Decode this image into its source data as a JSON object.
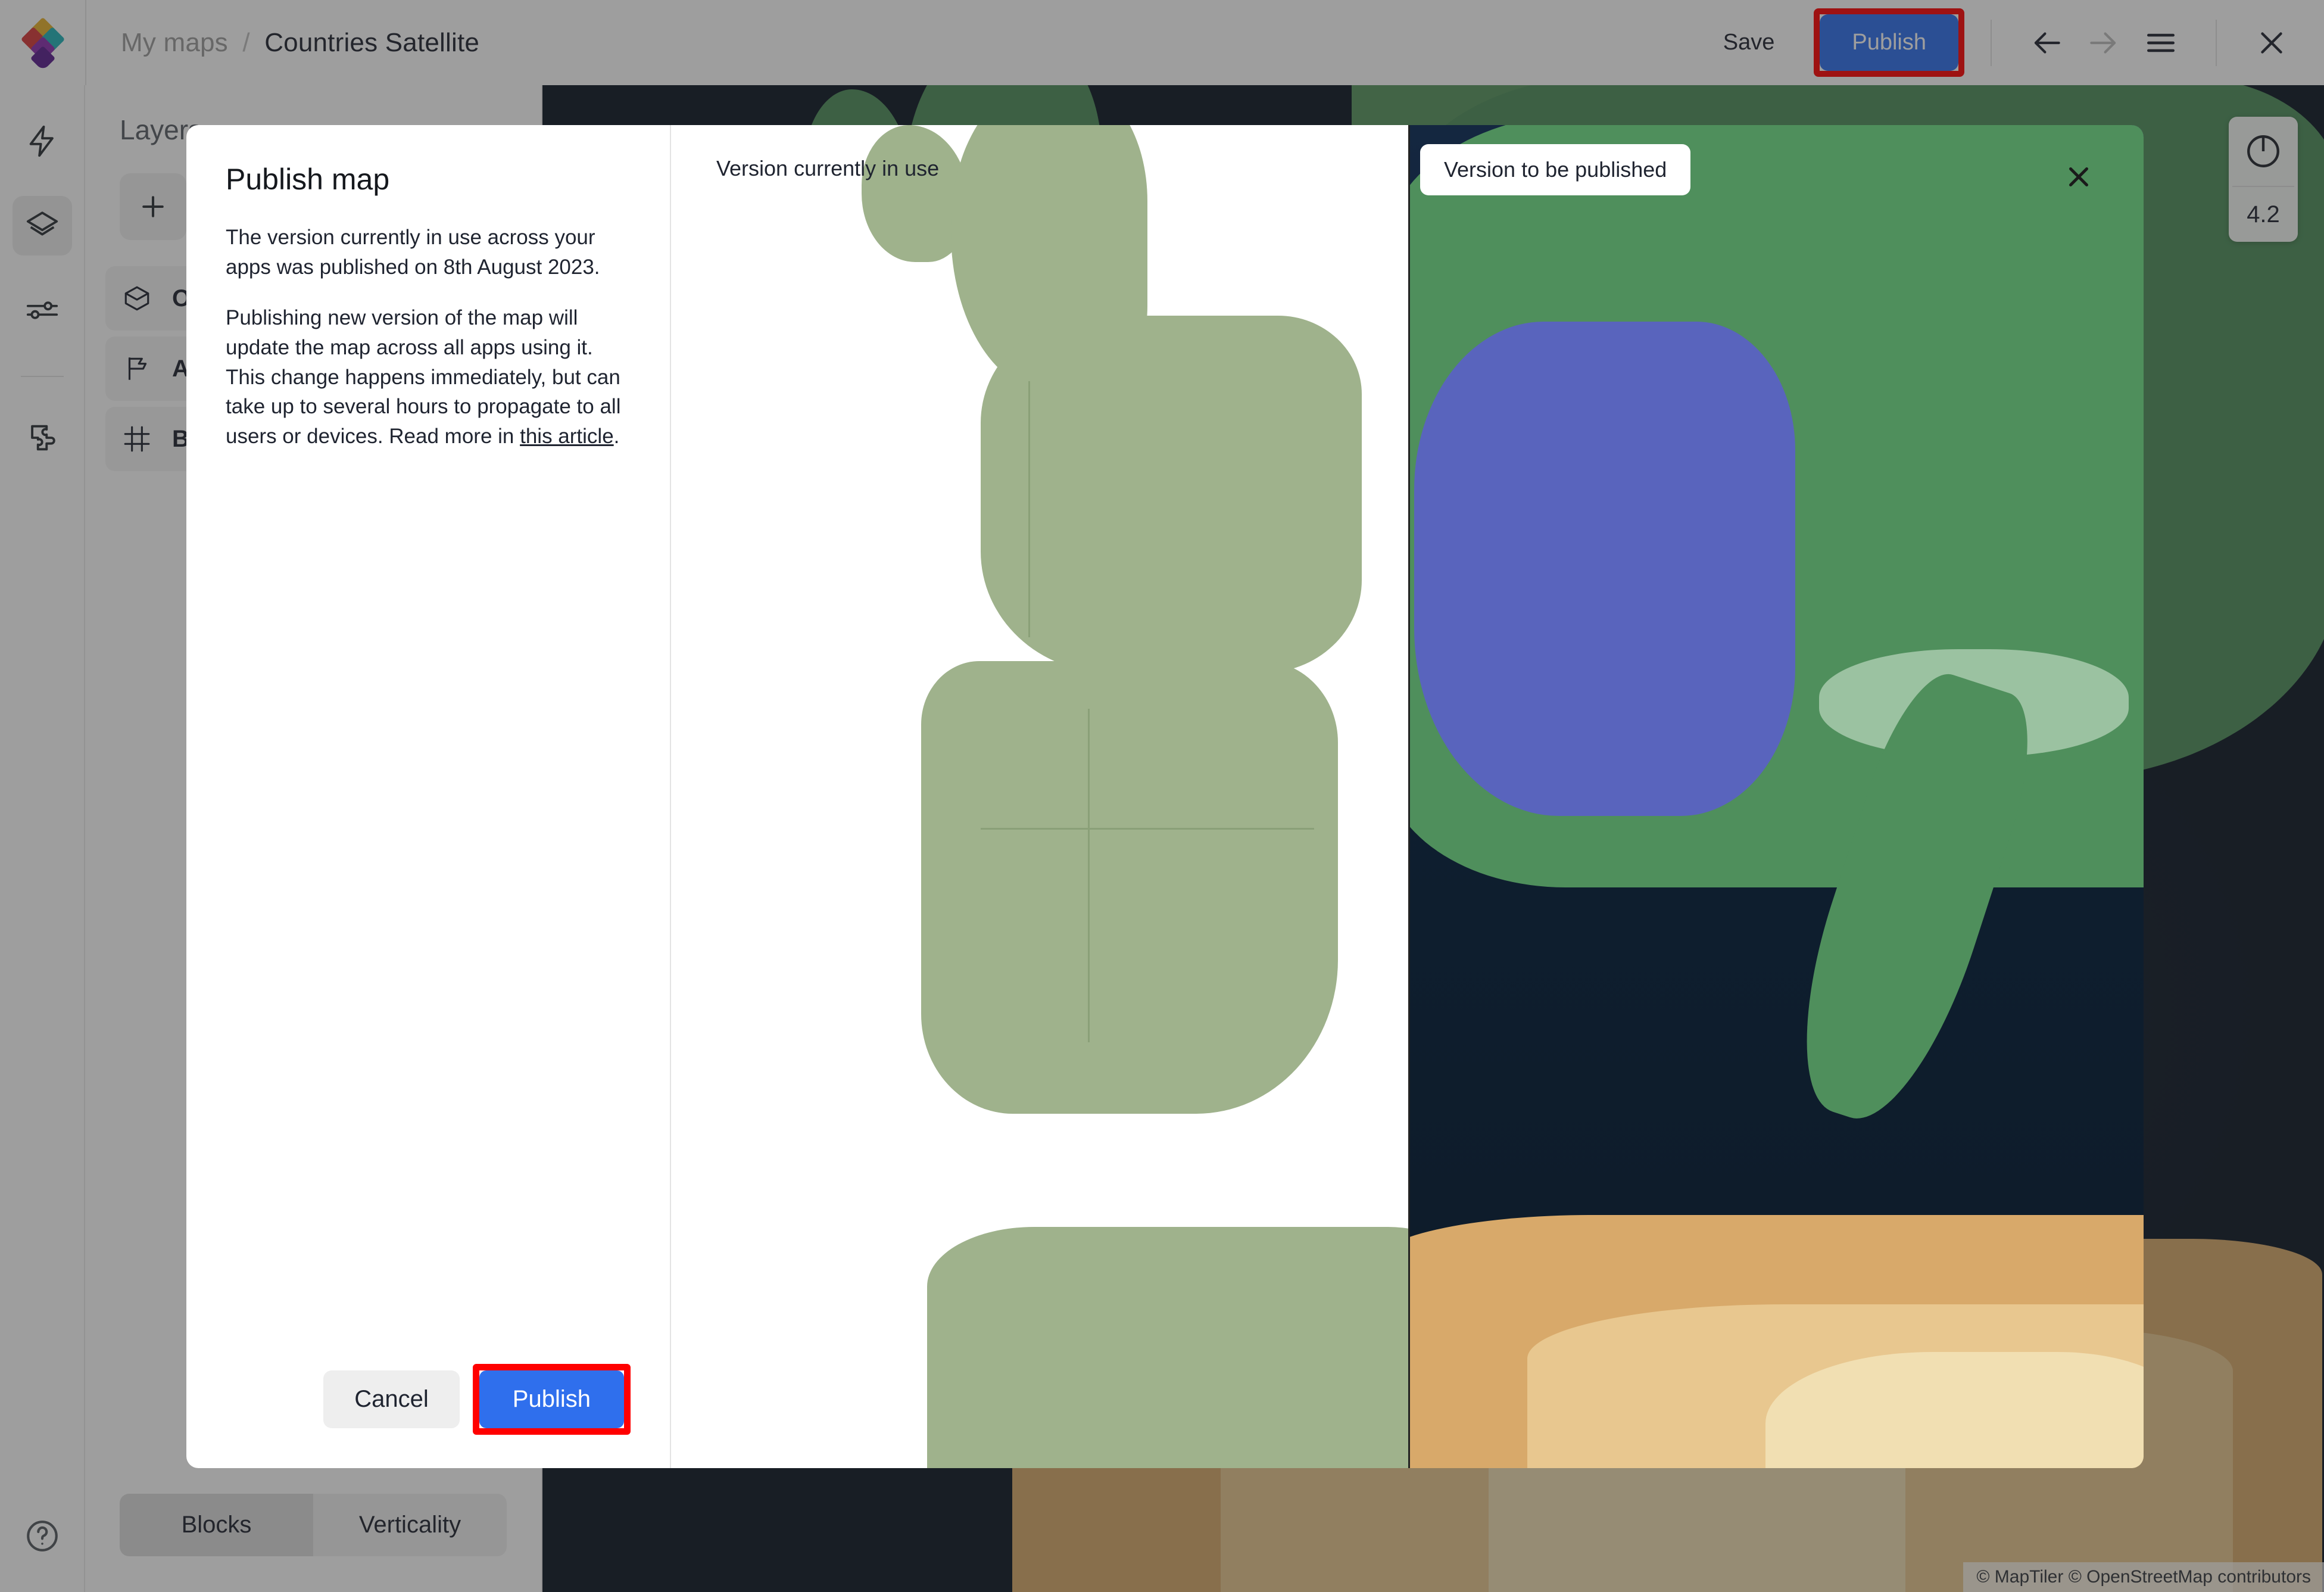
{
  "header": {
    "logo_icon": "maptiler-logo-icon",
    "breadcrumb_parent": "My maps",
    "breadcrumb_sep": "/",
    "breadcrumb_current": "Countries Satellite",
    "save_label": "Save",
    "publish_label": "Publish",
    "back_icon": "arrow-left-icon",
    "forward_icon": "arrow-right-icon",
    "menu_icon": "hamburger-menu-icon",
    "close_icon": "close-icon"
  },
  "rail": {
    "items": [
      {
        "icon": "lightning-bolt-icon",
        "name": "sidebar-item-quick-actions",
        "active": false
      },
      {
        "icon": "layers-icon",
        "name": "sidebar-item-layers",
        "active": true
      },
      {
        "icon": "sliders-icon",
        "name": "sidebar-item-settings",
        "active": false
      },
      {
        "icon": "puzzle-piece-icon",
        "name": "sidebar-item-plugins",
        "active": false
      }
    ],
    "help_icon": "help-circle-icon"
  },
  "panel": {
    "title": "Layers",
    "add_icon": "plus-icon",
    "layers": [
      {
        "icon": "cube-icon",
        "label": "Ot"
      },
      {
        "icon": "flag-icon",
        "label": "Ad"
      },
      {
        "icon": "frame-icon",
        "label": "Ba"
      }
    ],
    "tabs": [
      {
        "label": "Blocks",
        "selected": true
      },
      {
        "label": "Verticality",
        "selected": false
      }
    ]
  },
  "map_controls": {
    "compass_icon": "compass-icon",
    "zoom_level": "4.2",
    "attribution": "© MapTiler © OpenStreetMap contributors"
  },
  "dialog": {
    "title": "Publish map",
    "paragraph1": "The version currently in use across your apps was published on 8th August 2023.",
    "paragraph2_before": "Publishing new version of the map will update the map across all apps using it. This change happens immediately, but can take up to several hours to propagate to all users or devices. Read more in ",
    "paragraph2_link": "this article",
    "paragraph2_after": ".",
    "cancel_label": "Cancel",
    "publish_label": "Publish",
    "preview": {
      "label_old": "Version currently in use",
      "label_new": "Version to be published",
      "close_icon": "close-icon"
    }
  },
  "colors": {
    "accent_blue": "#2f6fed",
    "annotation_red": "#ff0000",
    "old_map_land": "#9fb28c",
    "new_map_highlight": "#5a62c2"
  }
}
